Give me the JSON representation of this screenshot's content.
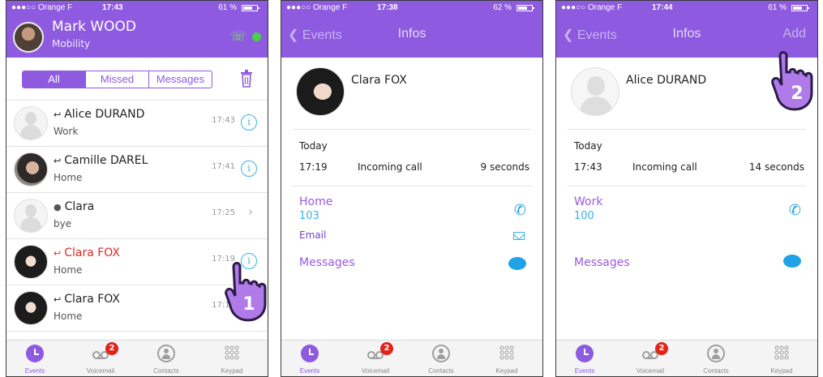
{
  "status": {
    "carrier": "●●●○○ Orange F",
    "screens": [
      {
        "time": "17:43",
        "battery": "61 %"
      },
      {
        "time": "17:38",
        "battery": "62 %"
      },
      {
        "time": "17:44",
        "battery": "61 %"
      }
    ]
  },
  "events": {
    "user_name": "Mark WOOD",
    "user_sub": "Mobility",
    "filters": [
      "All",
      "Missed",
      "Messages"
    ],
    "rows": [
      {
        "name": "Alice DURAND",
        "sub": "Work",
        "time": "17:43"
      },
      {
        "name": "Camille DAREL",
        "sub": "Home",
        "time": "17:41"
      },
      {
        "name": "Clara",
        "sub": "bye",
        "time": "17:25"
      },
      {
        "name": "Clara FOX",
        "sub": "Home",
        "time": "17:19"
      },
      {
        "name": "Clara FOX",
        "sub": "Home",
        "time": "17:19"
      }
    ]
  },
  "nav": {
    "back": "Events",
    "title": "Infos",
    "add": "Add"
  },
  "tabs": {
    "events": "Events",
    "voicemail": "Voicemail",
    "contacts": "Contacts",
    "keypad": "Keypad",
    "badge": "2"
  },
  "clara": {
    "name": "Clara FOX",
    "day": "Today",
    "time": "17:19",
    "desc": "Incoming call",
    "duration": "9 seconds",
    "home_label": "Home",
    "home_number": "103",
    "email_label": "Email",
    "messages_label": "Messages"
  },
  "alice": {
    "name": "Alice DURAND",
    "day": "Today",
    "time": "17:43",
    "desc": "Incoming call",
    "duration": "14 seconds",
    "work_label": "Work",
    "work_number": "100",
    "messages_label": "Messages"
  },
  "steps": {
    "one": "1",
    "two": "2"
  },
  "colors": {
    "accent": "#8e5ae0",
    "link": "#36b3ea",
    "missed": "#e52626",
    "badge": "#e2231a"
  }
}
